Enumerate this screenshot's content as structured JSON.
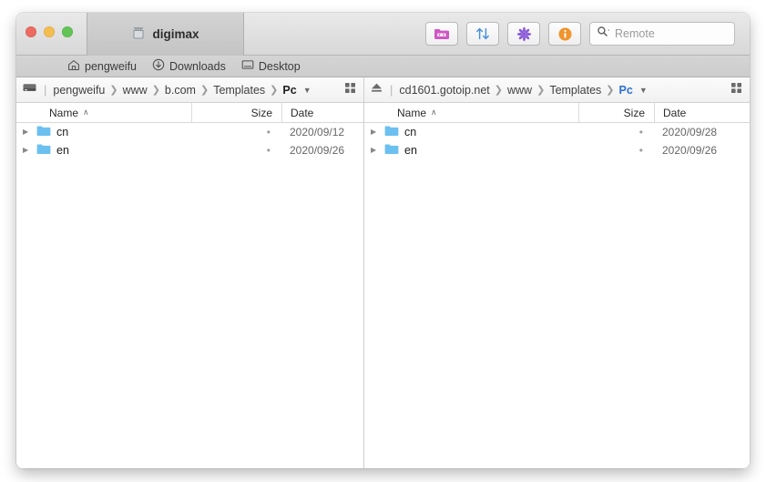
{
  "window": {
    "traffic_lights": [
      "close",
      "minimize",
      "maximize"
    ],
    "tab_label": "digimax",
    "tab_icon": "ethernet-port-icon"
  },
  "toolbar": {
    "buttons": [
      {
        "name": "new-folder-button",
        "icon": "folder-icon",
        "color": "#d45bc8"
      },
      {
        "name": "transfer-button",
        "icon": "up-down-arrows-icon",
        "color": "#4a90d9"
      },
      {
        "name": "synchronize-button",
        "icon": "asterisk-icon",
        "color": "#8b5cd6"
      },
      {
        "name": "info-button",
        "icon": "info-circle-icon",
        "color": "#f0942b"
      }
    ],
    "search": {
      "icon": "search-icon",
      "placeholder": "Remote",
      "value": ""
    }
  },
  "favorites": [
    {
      "icon": "home-icon",
      "label": "pengweifu"
    },
    {
      "icon": "downloads-icon",
      "label": "Downloads"
    },
    {
      "icon": "desktop-icon",
      "label": "Desktop"
    }
  ],
  "panes": {
    "left": {
      "location_icon": "hard-drive-icon",
      "crumbs": [
        "pengweifu",
        "www",
        "b.com",
        "Templates",
        "Pc"
      ],
      "current_crumb": "Pc",
      "current_accent": false,
      "view_icon": "grid-view-icon",
      "columns": [
        "Name",
        "Size",
        "Date"
      ],
      "sort_column": "Name",
      "sort_caret": "∧",
      "rows": [
        {
          "name": "cn",
          "size": "•",
          "date": "2020/09/12",
          "icon": "folder-icon",
          "expanded": false
        },
        {
          "name": "en",
          "size": "•",
          "date": "2020/09/26",
          "icon": "folder-icon",
          "expanded": false
        }
      ]
    },
    "right": {
      "location_icon": "eject-icon",
      "crumbs": [
        "cd1601.gotoip.net",
        "www",
        "Templates",
        "Pc"
      ],
      "current_crumb": "Pc",
      "current_accent": true,
      "view_icon": "grid-view-icon",
      "columns": [
        "Name",
        "Size",
        "Date"
      ],
      "sort_column": "Name",
      "sort_caret": "∧",
      "rows": [
        {
          "name": "cn",
          "size": "•",
          "date": "2020/09/28",
          "icon": "folder-icon",
          "expanded": false
        },
        {
          "name": "en",
          "size": "•",
          "date": "2020/09/26",
          "icon": "folder-icon",
          "expanded": false
        }
      ]
    }
  },
  "colors": {
    "accent": "#2d6fd4",
    "folder": "#6cc0f0",
    "titlebar": "#dedede"
  }
}
